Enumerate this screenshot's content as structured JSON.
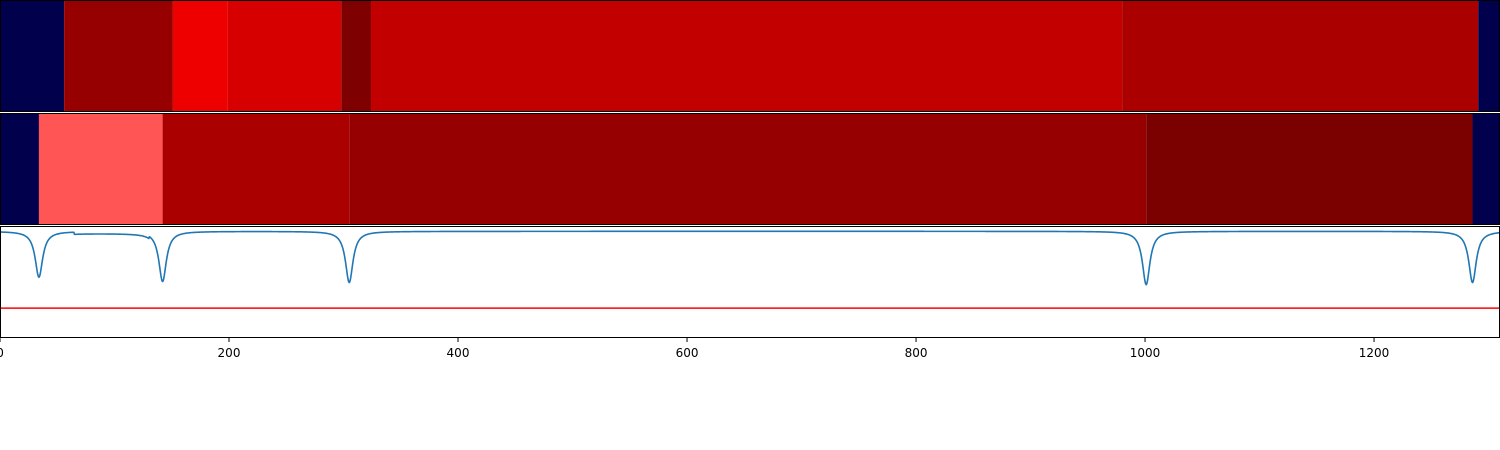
{
  "chart_data": {
    "type": "heatmap",
    "xlim": [
      0,
      1310
    ],
    "xticks": [
      0,
      200,
      400,
      600,
      800,
      1000,
      1200
    ],
    "xtick_labels": [
      "0",
      "200",
      "400",
      "600",
      "800",
      "1000",
      "1200"
    ],
    "xlabel": "",
    "ylabel": "",
    "title": "",
    "grid": false,
    "legend": "none",
    "colormap": "seismic",
    "color_scale_fraction_note": "each segment value is its position on the blue-white-red colormap (0 = dark blue, 0.5 = white, 1 = dark red)",
    "rows": [
      {
        "segments": [
          {
            "x0": 0,
            "x1": 56,
            "value": 0.0,
            "color": "#00004c"
          },
          {
            "x0": 56,
            "x1": 151,
            "value": 0.91,
            "color": "#970000"
          },
          {
            "x0": 151,
            "x1": 199,
            "value": 0.72,
            "color": "#ee0000"
          },
          {
            "x0": 199,
            "x1": 298,
            "value": 0.79,
            "color": "#d60000"
          },
          {
            "x0": 298,
            "x1": 324,
            "value": 0.99,
            "color": "#7e0000"
          },
          {
            "x0": 324,
            "x1": 980,
            "value": 0.83,
            "color": "#c30000"
          },
          {
            "x0": 980,
            "x1": 1291,
            "value": 0.88,
            "color": "#ab0000"
          },
          {
            "x0": 1291,
            "x1": 1310,
            "value": 0.0,
            "color": "#00004c"
          }
        ]
      },
      {
        "segments": [
          {
            "x0": 0,
            "x1": 34,
            "value": 0.0,
            "color": "#00004c"
          },
          {
            "x0": 34,
            "x1": 142,
            "value": 0.65,
            "color": "#ff5555"
          },
          {
            "x0": 142,
            "x1": 305,
            "value": 0.88,
            "color": "#ab0000"
          },
          {
            "x0": 305,
            "x1": 1001,
            "value": 0.91,
            "color": "#970000"
          },
          {
            "x0": 1001,
            "x1": 1286,
            "value": 1.0,
            "color": "#7b0000"
          },
          {
            "x0": 1286,
            "x1": 1310,
            "value": 0.0,
            "color": "#00004c"
          }
        ]
      }
    ],
    "signal_panel": {
      "ylim": [
        -1.0,
        0.05
      ],
      "series": [
        {
          "color": "#1f77b4",
          "baseline": 0.0,
          "dips": [
            {
              "x": 34,
              "depth": -0.43
            },
            {
              "x": 142,
              "depth": -0.47
            },
            {
              "x": 305,
              "depth": -0.48
            },
            {
              "x": 1001,
              "depth": -0.5
            },
            {
              "x": 1286,
              "depth": -0.48
            }
          ],
          "plateau": {
            "x0": 65,
            "x1": 130,
            "value": -0.02
          }
        }
      ],
      "threshold": {
        "y": -0.72,
        "color": "#ff0000"
      }
    }
  }
}
